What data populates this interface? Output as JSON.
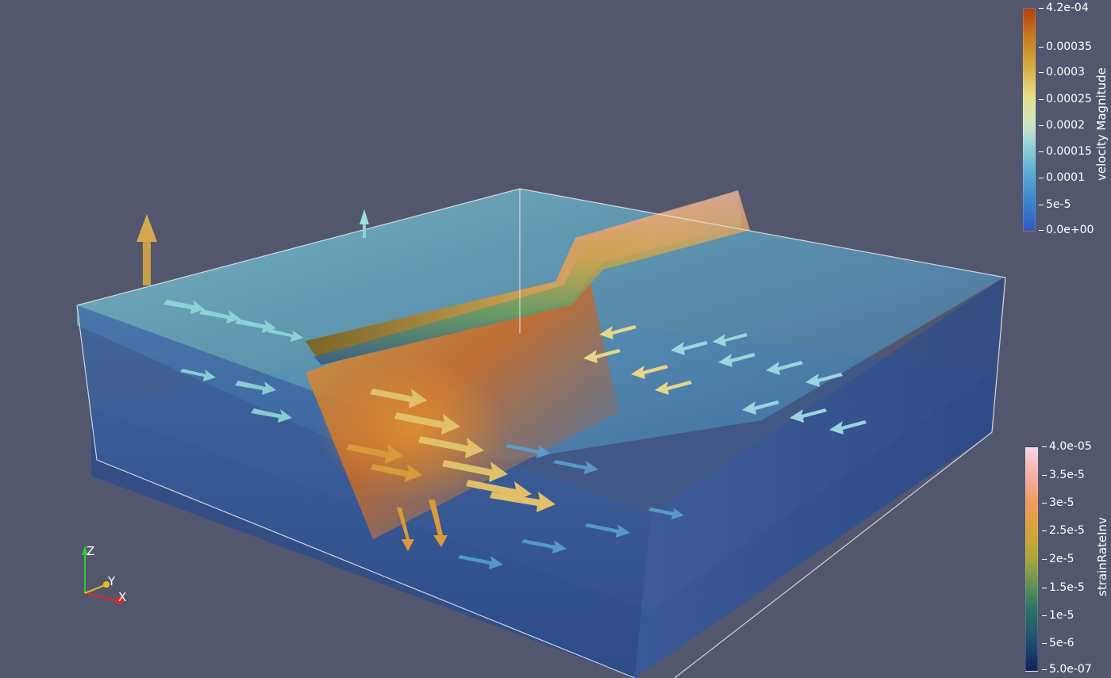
{
  "viewport": {
    "background": "#52576e"
  },
  "colorbars": {
    "velocity": {
      "title": "velocity Magnitude",
      "ticks": [
        "4.2e-04",
        "0.00035",
        "0.0003",
        "0.00025",
        "0.0002",
        "0.00015",
        "0.0001",
        "5e-5",
        "0.0e+00"
      ],
      "range": [
        0.0,
        0.00042
      ]
    },
    "strain": {
      "title": "strainRateInv",
      "ticks": [
        "4.0e-05",
        "3.5e-5",
        "3e-5",
        "2.5e-5",
        "2e-5",
        "1.5e-5",
        "1e-5",
        "5e-6",
        "5.0e-07"
      ],
      "range": [
        5e-07,
        4e-05
      ]
    }
  },
  "orientation_axes": {
    "z_label": "Z",
    "y_label": "Y",
    "x_label": "X",
    "colors": {
      "x": "#e8241e",
      "y": "#e0c020",
      "z": "#2ecc2e"
    }
  }
}
